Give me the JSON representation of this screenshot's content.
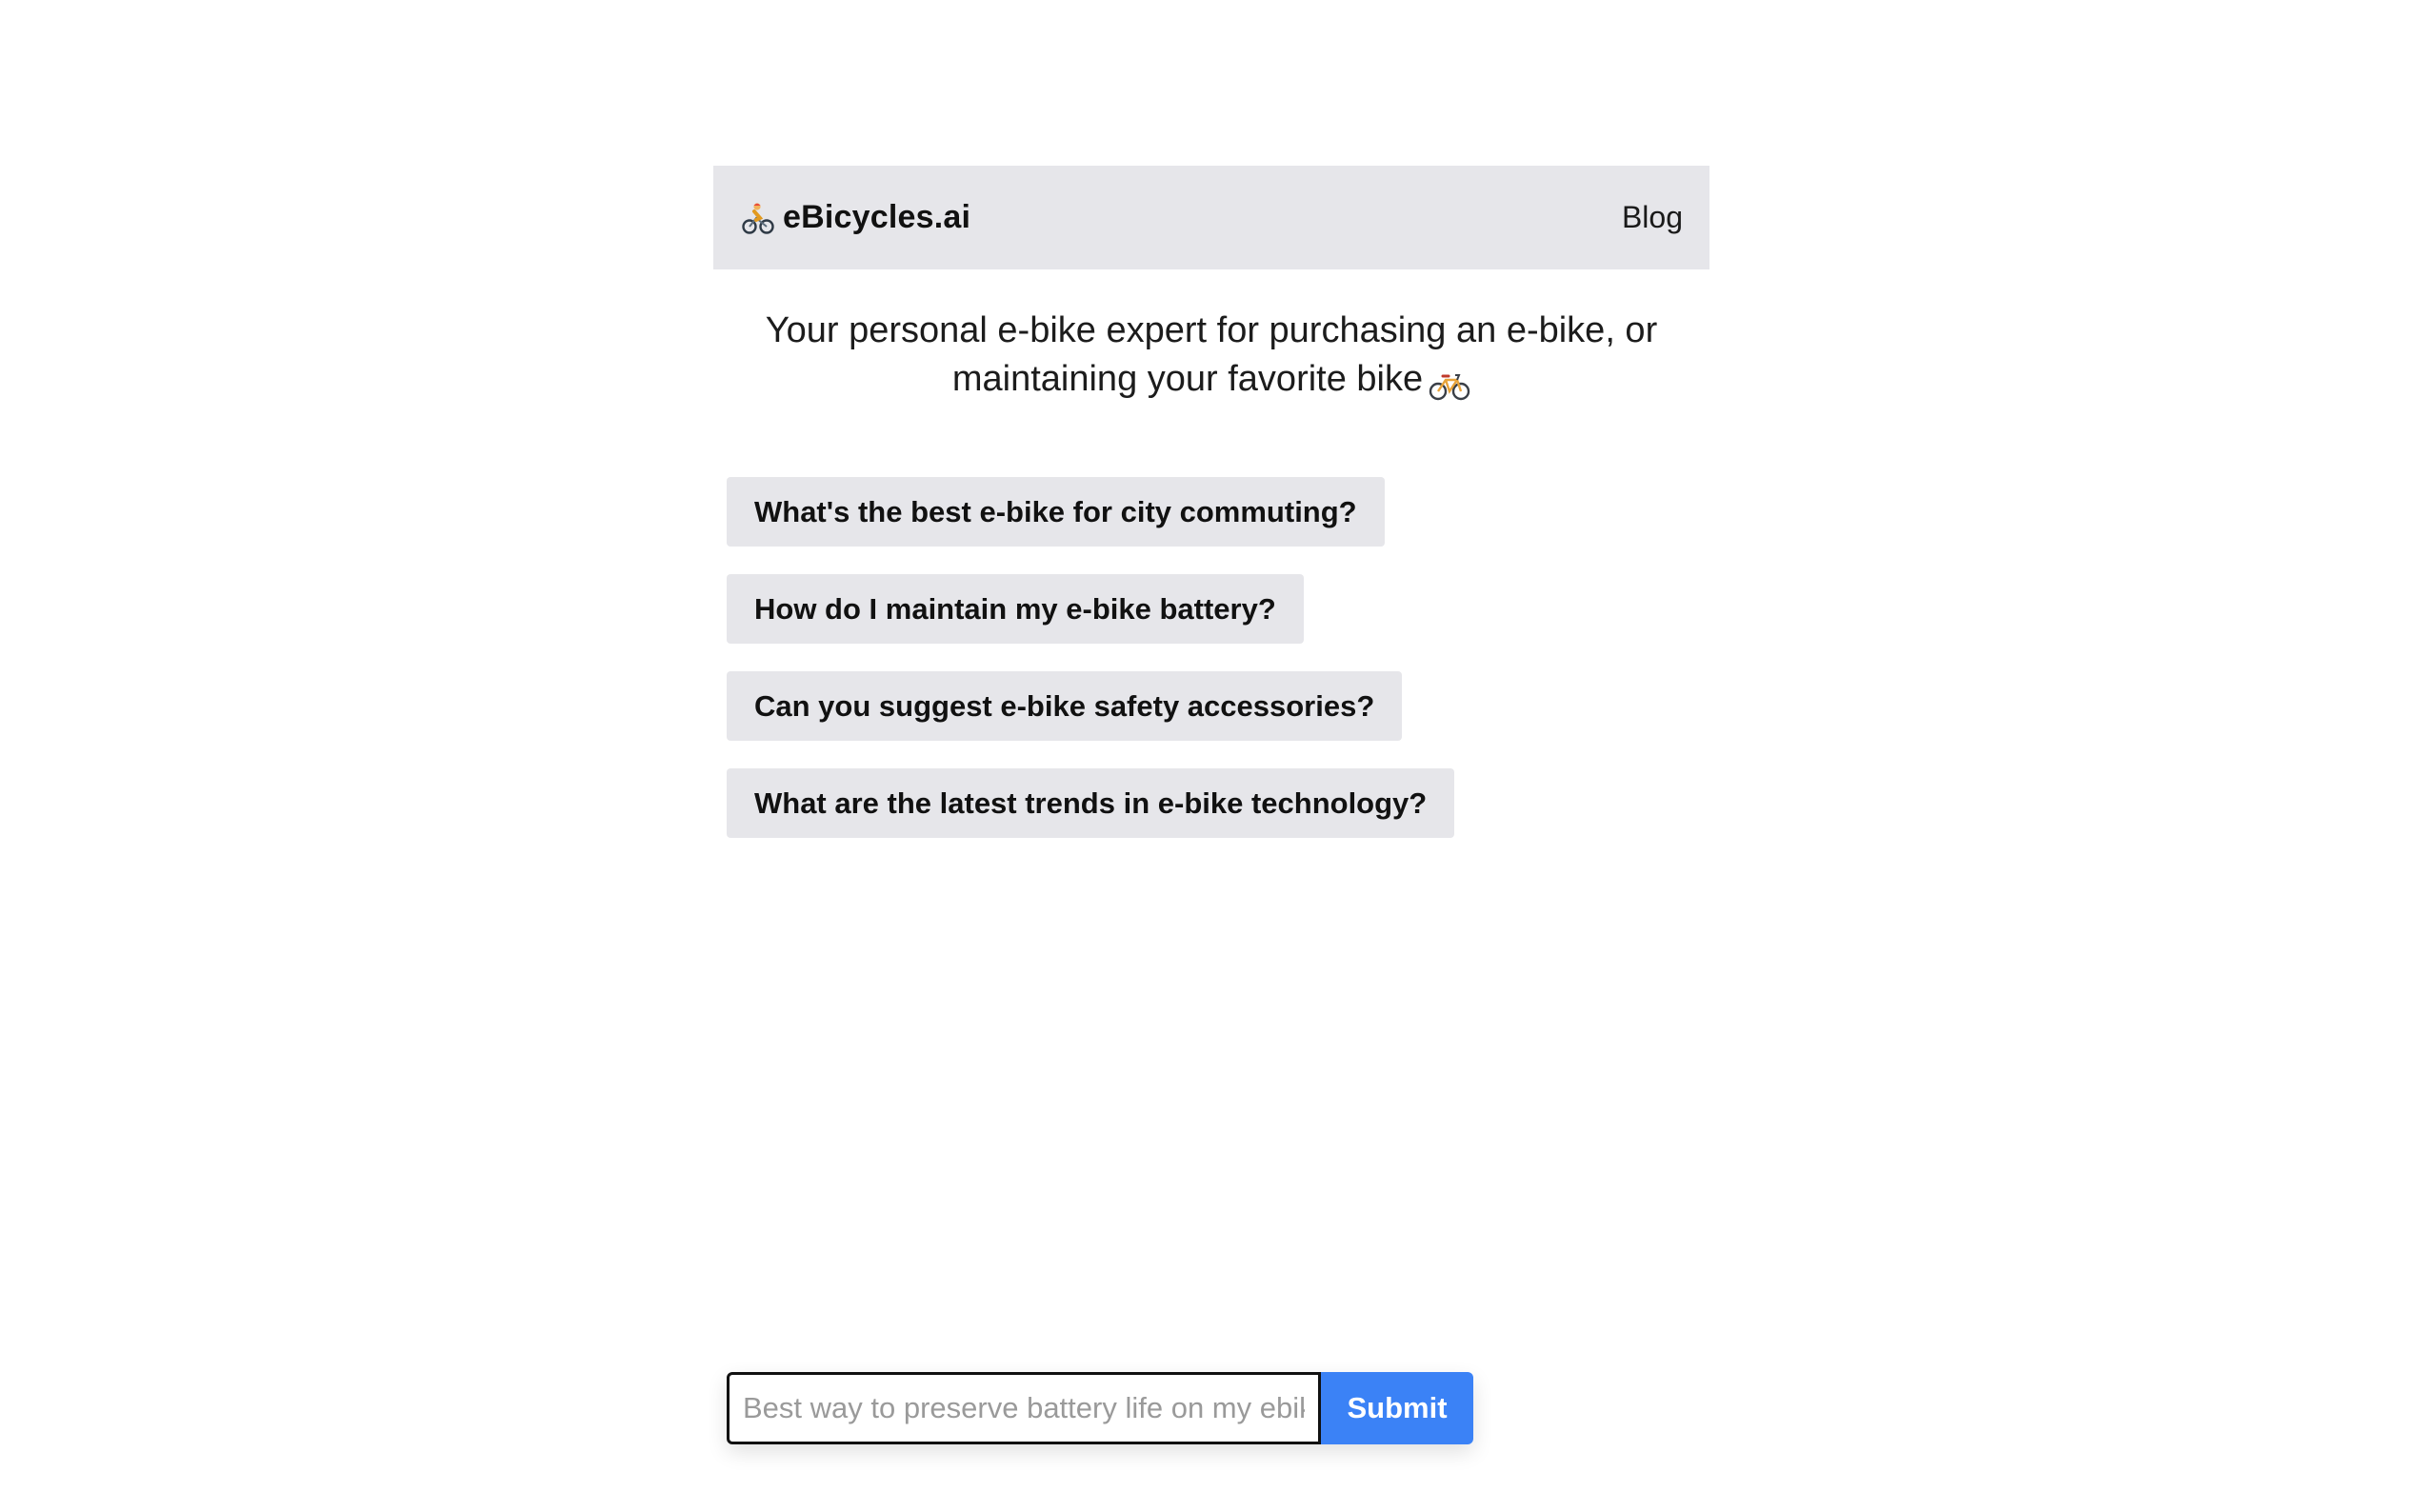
{
  "header": {
    "brand_icon": "cyclist-icon",
    "brand_name": "eBicycles.ai",
    "nav_link": "Blog"
  },
  "tagline": {
    "text": "Your personal e-bike expert for purchasing an e-bike, or maintaining your favorite bike",
    "icon": "bicycle-icon"
  },
  "suggestions": [
    "What's the best e-bike for city commuting?",
    "How do I maintain my e-bike battery?",
    "Can you suggest e-bike safety accessories?",
    "What are the latest trends in e-bike technology?"
  ],
  "composer": {
    "value": "",
    "placeholder": "Best way to preserve battery life on my ebike?",
    "submit_label": "Submit"
  },
  "colors": {
    "header_bg": "#e6e6ea",
    "suggestion_bg": "#e6e6ea",
    "submit_bg": "#3b82f6"
  }
}
